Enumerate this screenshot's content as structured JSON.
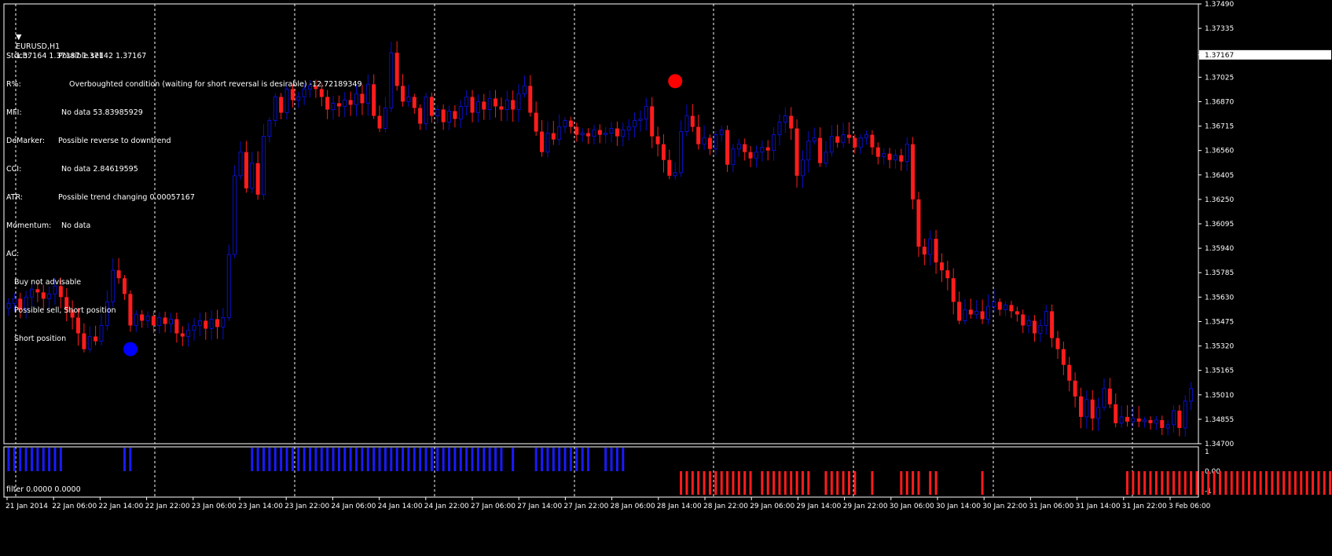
{
  "header": {
    "symbol": "EURUSD,H1",
    "ohlc": "1.37164 1.37187 1.37142 1.37167",
    "menu_icon": "triangle-down-icon"
  },
  "signals": [
    {
      "key": "Stoch:",
      "value": "Possible sell"
    },
    {
      "key": "R%:",
      "value": "Overboughted condition (waiting for short reversal is desirable) -12.72189349"
    },
    {
      "key": "MFI:",
      "value": "No data 53.83985929"
    },
    {
      "key": "DeMarker:",
      "value": "Possible reverse to downtrend"
    },
    {
      "key": "CCI:",
      "value": "No data 2.84619595"
    },
    {
      "key": "ATR:",
      "value": "Possible trend changing 0.00057167"
    },
    {
      "key": "Momentum:",
      "value": "No data"
    },
    {
      "key": "AC:",
      "value": ""
    }
  ],
  "advice": [
    "Buy not advisable",
    "Possible sell, Short position",
    "Short position"
  ],
  "subwindow": {
    "label": "filter 0.0000 0.0000"
  },
  "colors": {
    "background": "#000000",
    "bull": "#0a10c8",
    "bear": "#ff1c1c",
    "grid": "#ffffff",
    "text": "#ffffff",
    "price_tag_bg": "#ffffff"
  },
  "chart_data": {
    "type": "candlestick",
    "symbol": "EURUSD",
    "timeframe": "H1",
    "ylim": [
      1.347,
      1.3749
    ],
    "y_ticks": [
      "1.37490",
      "1.37335",
      "1.37167",
      "1.37025",
      "1.36870",
      "1.36715",
      "1.36560",
      "1.36405",
      "1.36250",
      "1.36095",
      "1.35940",
      "1.35785",
      "1.35630",
      "1.35475",
      "1.35320",
      "1.35165",
      "1.35010",
      "1.34855",
      "1.34700"
    ],
    "current_price": "1.37167",
    "x_ticks": [
      "21 Jan 2014",
      "22 Jan 06:00",
      "22 Jan 14:00",
      "22 Jan 22:00",
      "23 Jan 06:00",
      "23 Jan 14:00",
      "23 Jan 22:00",
      "24 Jan 06:00",
      "24 Jan 14:00",
      "24 Jan 22:00",
      "27 Jan 06:00",
      "27 Jan 14:00",
      "27 Jan 22:00",
      "28 Jan 06:00",
      "28 Jan 14:00",
      "28 Jan 22:00",
      "29 Jan 06:00",
      "29 Jan 14:00",
      "29 Jan 22:00",
      "30 Jan 06:00",
      "30 Jan 14:00",
      "30 Jan 22:00",
      "31 Jan 06:00",
      "31 Jan 14:00",
      "31 Jan 22:00",
      "3 Feb 06:00"
    ],
    "grid": "vertical dashed day separators",
    "closes": [
      1.3559,
      1.3562,
      1.3555,
      1.3563,
      1.3568,
      1.3566,
      1.3562,
      1.3565,
      1.357,
      1.3563,
      1.3555,
      1.355,
      1.354,
      1.353,
      1.3538,
      1.3535,
      1.3545,
      1.356,
      1.358,
      1.3575,
      1.3565,
      1.3545,
      1.3552,
      1.3548,
      1.3551,
      1.3545,
      1.355,
      1.3546,
      1.3549,
      1.354,
      1.3538,
      1.3542,
      1.3545,
      1.3548,
      1.3543,
      1.3549,
      1.3544,
      1.355,
      1.359,
      1.364,
      1.3655,
      1.3632,
      1.3648,
      1.3628,
      1.3665,
      1.3675,
      1.369,
      1.368,
      1.3695,
      1.3688,
      1.369,
      1.3695,
      1.3697,
      1.3695,
      1.369,
      1.3682,
      1.3686,
      1.3684,
      1.3688,
      1.3685,
      1.3692,
      1.3686,
      1.3698,
      1.3678,
      1.367,
      1.3683,
      1.3718,
      1.3697,
      1.3687,
      1.369,
      1.3683,
      1.3673,
      1.369,
      1.3678,
      1.3682,
      1.3674,
      1.3681,
      1.3676,
      1.3684,
      1.369,
      1.368,
      1.3687,
      1.3682,
      1.3689,
      1.3684,
      1.3682,
      1.3688,
      1.3682,
      1.3692,
      1.3697,
      1.368,
      1.3668,
      1.3655,
      1.3667,
      1.3663,
      1.3671,
      1.3675,
      1.3671,
      1.3666,
      1.3667,
      1.3665,
      1.3669,
      1.3666,
      1.3667,
      1.367,
      1.3665,
      1.3669,
      1.3671,
      1.3675,
      1.3676,
      1.3684,
      1.3665,
      1.366,
      1.365,
      1.364,
      1.3642,
      1.3668,
      1.3678,
      1.3671,
      1.366,
      1.3664,
      1.3657,
      1.3666,
      1.3669,
      1.3647,
      1.3657,
      1.366,
      1.3655,
      1.3651,
      1.3655,
      1.3658,
      1.3656,
      1.3666,
      1.3674,
      1.3678,
      1.367,
      1.364,
      1.365,
      1.3662,
      1.3664,
      1.3648,
      1.3655,
      1.3665,
      1.3661,
      1.3666,
      1.3664,
      1.3658,
      1.3664,
      1.3666,
      1.3658,
      1.3652,
      1.3654,
      1.365,
      1.3653,
      1.3649,
      1.366,
      1.3625,
      1.3595,
      1.359,
      1.36,
      1.3585,
      1.358,
      1.3575,
      1.356,
      1.3548,
      1.3555,
      1.3552,
      1.3554,
      1.3549,
      1.3557,
      1.356,
      1.3555,
      1.3558,
      1.3554,
      1.3552,
      1.3545,
      1.3548,
      1.354,
      1.3545,
      1.3554,
      1.3537,
      1.353,
      1.352,
      1.351,
      1.35,
      1.3487,
      1.3498,
      1.3486,
      1.3493,
      1.3505,
      1.3495,
      1.3483,
      1.3487,
      1.3484,
      1.3486,
      1.3484,
      1.3485,
      1.3483,
      1.3485,
      1.348,
      1.3482,
      1.3491,
      1.348,
      1.3497,
      1.3505
    ],
    "markers": [
      {
        "type": "buy-dot",
        "color": "#0000ff",
        "bar": 21,
        "price": 1.353
      },
      {
        "type": "sell-dot",
        "color": "#ff0000",
        "bar": 115,
        "price": 1.37
      }
    ],
    "filter_histogram": {
      "ylim": [
        -1,
        1
      ],
      "y_ticks": [
        "1",
        "0.00",
        "0.00",
        "-1"
      ],
      "blue_bars": [
        [
          0,
          9
        ],
        [
          20,
          21
        ],
        [
          42,
          85
        ],
        [
          87,
          87
        ],
        [
          91,
          100
        ],
        [
          103,
          106
        ]
      ],
      "red_bars": [
        [
          116,
          128
        ],
        [
          130,
          138
        ],
        [
          141,
          146
        ],
        [
          149,
          149
        ],
        [
          154,
          157
        ],
        [
          159,
          160
        ],
        [
          168,
          168
        ],
        [
          193,
          255
        ]
      ]
    }
  }
}
